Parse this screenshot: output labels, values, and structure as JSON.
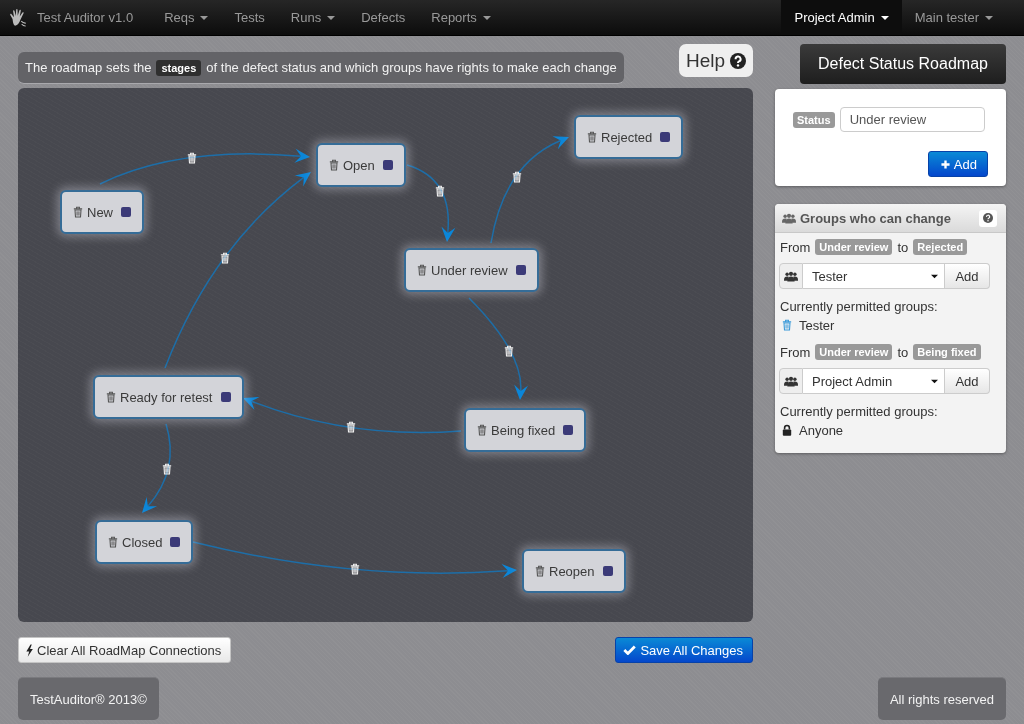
{
  "navbar": {
    "brand": "Test Auditor v1.0",
    "items": [
      {
        "label": "Reqs",
        "dropdown": true,
        "selected": false
      },
      {
        "label": "Tests",
        "dropdown": false,
        "selected": false
      },
      {
        "label": "Runs",
        "dropdown": true,
        "selected": false
      },
      {
        "label": "Defects",
        "dropdown": false,
        "selected": false
      },
      {
        "label": "Reports",
        "dropdown": true,
        "selected": false
      }
    ],
    "right_items": [
      {
        "label": "Project Admin",
        "dropdown": true,
        "selected": true
      },
      {
        "label": "Main tester",
        "dropdown": true,
        "selected": false
      }
    ]
  },
  "info_bar": {
    "text_before": "The roadmap sets the",
    "keyword": "stages",
    "text_after": "of the defect status and which groups have rights to make each change"
  },
  "help_button": {
    "label": "Help"
  },
  "roadmap": {
    "stages": [
      {
        "label": "Rejected"
      },
      {
        "label": "Open"
      },
      {
        "label": "New"
      },
      {
        "label": "Under review"
      },
      {
        "label": "Ready for retest"
      },
      {
        "label": "Being fixed"
      },
      {
        "label": "Closed"
      },
      {
        "label": "Reopen"
      }
    ]
  },
  "actions": {
    "clear_button": "Clear All RoadMap Connections",
    "save_button": "Save All Changes"
  },
  "sidebar": {
    "title": "Defect Status Roadmap",
    "status_form": {
      "label": "Status",
      "value": "Under review",
      "add_button": "Add"
    },
    "groups_panel": {
      "title": "Groups who can change",
      "transitions": [
        {
          "from_text": "From",
          "from": "Under review",
          "to_text": "to",
          "to": "Rejected",
          "group": "Tester",
          "add_button": "Add",
          "permitted_label": "Currently permitted groups:",
          "permitted": [
            {
              "name": "Tester",
              "kind": "removable"
            }
          ]
        },
        {
          "from_text": "From",
          "from": "Under review",
          "to_text": "to",
          "to": "Being fixed",
          "group": "Project Admin",
          "add_button": "Add",
          "permitted_label": "Currently permitted groups:",
          "permitted": [
            {
              "name": "Anyone",
              "kind": "locked"
            }
          ]
        }
      ]
    }
  },
  "footer": {
    "copyright": "TestAuditor® 2013©",
    "rights": "All rights reserved"
  }
}
